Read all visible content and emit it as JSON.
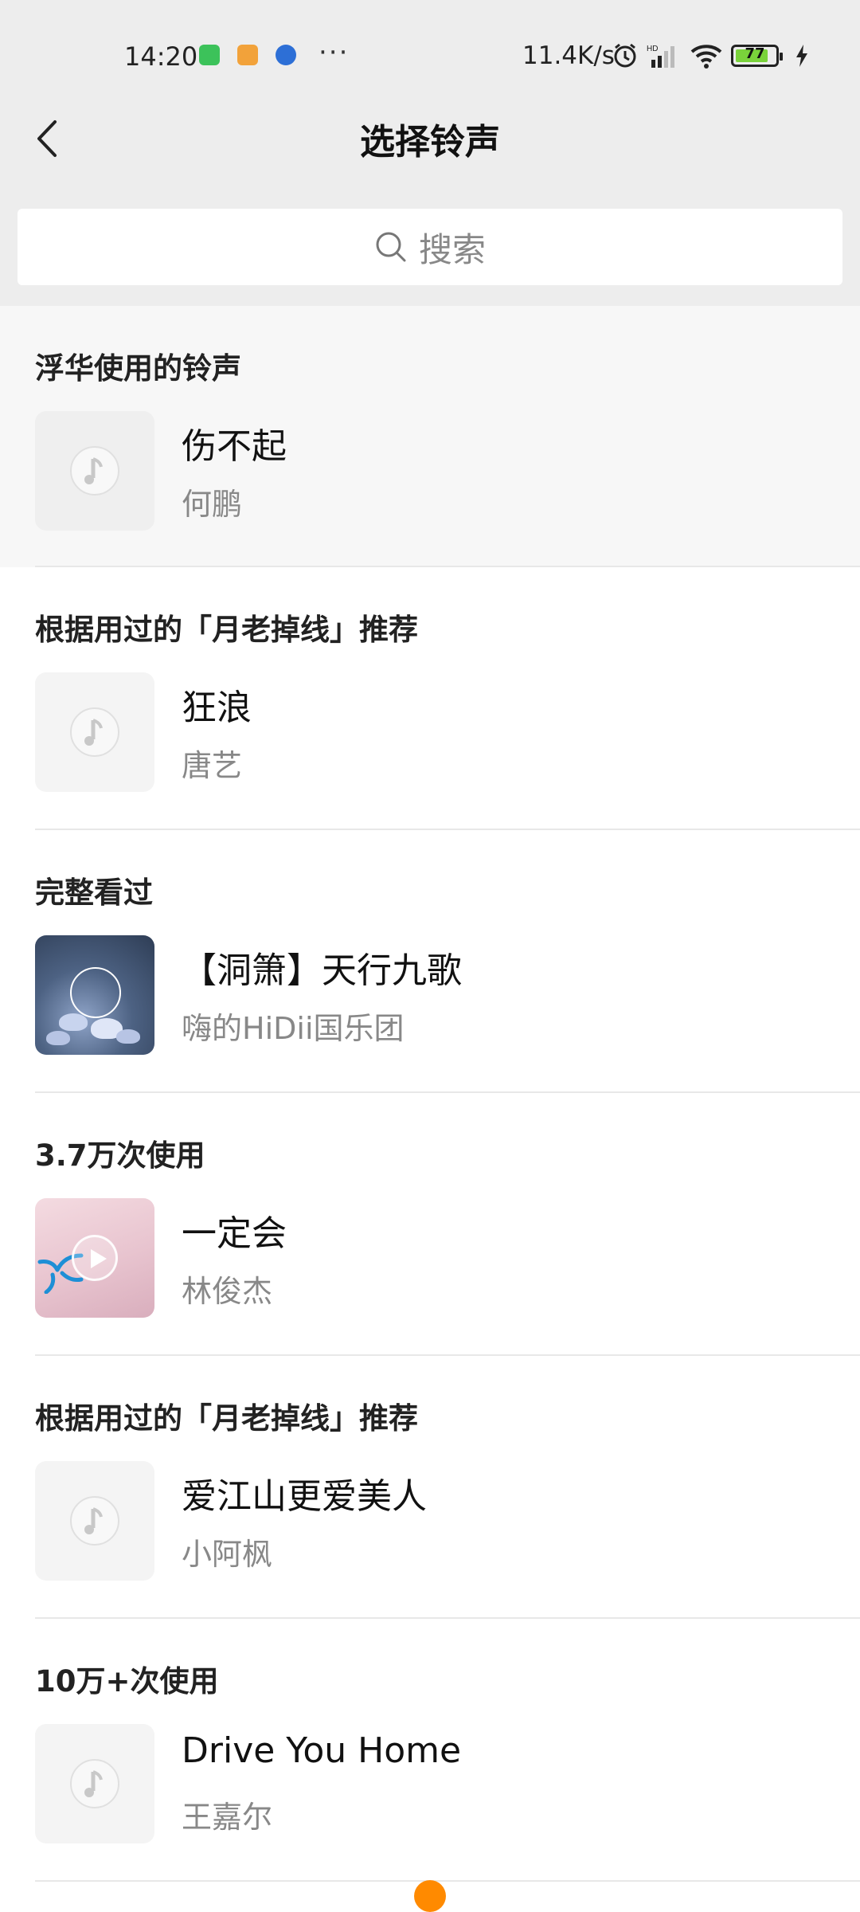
{
  "status_bar": {
    "time": "14:20",
    "more": "···",
    "net_speed": "11.4K/s",
    "battery_level": "77",
    "icons": [
      "app-notification-icon",
      "cat-app-icon",
      "bird-app-icon",
      "alarm-icon",
      "hd-icon",
      "signal-icon",
      "wifi-icon",
      "battery-icon",
      "charging-icon"
    ]
  },
  "header": {
    "title": "选择铃声",
    "back_icon": "back-arrow-icon"
  },
  "search": {
    "placeholder": "搜索",
    "icon": "search-icon"
  },
  "sections": [
    {
      "heading": "浮华使用的铃声",
      "song": "伤不起",
      "artist": "何鹏",
      "thumb": "music-note-placeholder"
    },
    {
      "heading": "根据用过的「月老掉线」推荐",
      "song": "狂浪",
      "artist": "唐艺",
      "thumb": "music-note-placeholder"
    },
    {
      "heading": "完整看过",
      "song": "【洞箫】天行九歌",
      "artist": "嗨的HiDii国乐团",
      "thumb": "lotus-album-art"
    },
    {
      "heading": "3.7万次使用",
      "song": "一定会",
      "artist": "林俊杰",
      "thumb": "pink-album-art-with-play"
    },
    {
      "heading": "根据用过的「月老掉线」推荐",
      "song": "爱江山更爱美人",
      "artist": "小阿枫",
      "thumb": "music-note-placeholder"
    },
    {
      "heading": "10万+次使用",
      "song": "Drive You Home",
      "artist": "王嘉尔",
      "thumb": "music-note-placeholder"
    }
  ],
  "colors": {
    "accent": "#ff8a00",
    "header_bg": "#ededed",
    "battery_fill": "#7ad33b"
  }
}
